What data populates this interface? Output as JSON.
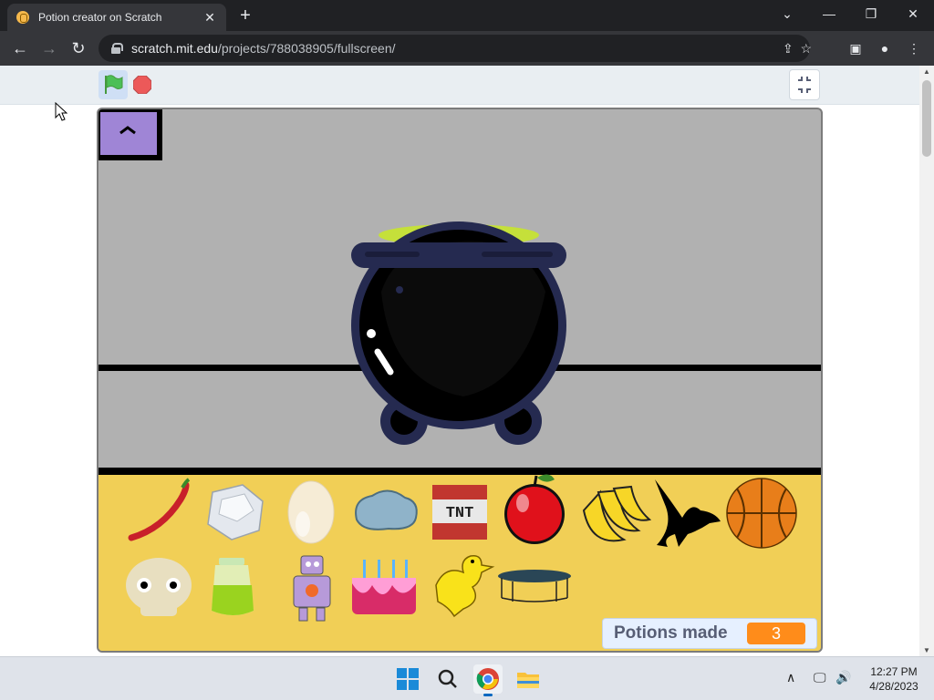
{
  "browser": {
    "tab_title": "Potion creator on Scratch",
    "new_tab_symbol": "+",
    "url_host": "scratch.mit.edu",
    "url_path": "/projects/788038905/fullscreen/"
  },
  "scratch": {
    "ingredients_row1": [
      "chili-pepper",
      "ice-cube",
      "egg",
      "rock",
      "tnt-block",
      "apple",
      "bananas",
      "crow",
      "basketball"
    ],
    "ingredients_row2": [
      "skull",
      "green-potion-jar",
      "robot",
      "birthday-cake",
      "duck",
      "trampoline"
    ],
    "tnt_text": "TNT",
    "counter": {
      "label": "Potions made",
      "value": "3"
    }
  },
  "taskbar": {
    "time": "12:27 PM",
    "date": "4/28/2023"
  },
  "colors": {
    "stage_gray": "#b1b1b1",
    "ingredient_panel": "#f1cf56",
    "counter_orange": "#ff8c1a",
    "toggle_button": "#9f85d6",
    "cauldron_rim": "#252a50",
    "potion_green": "#c5e03a"
  }
}
